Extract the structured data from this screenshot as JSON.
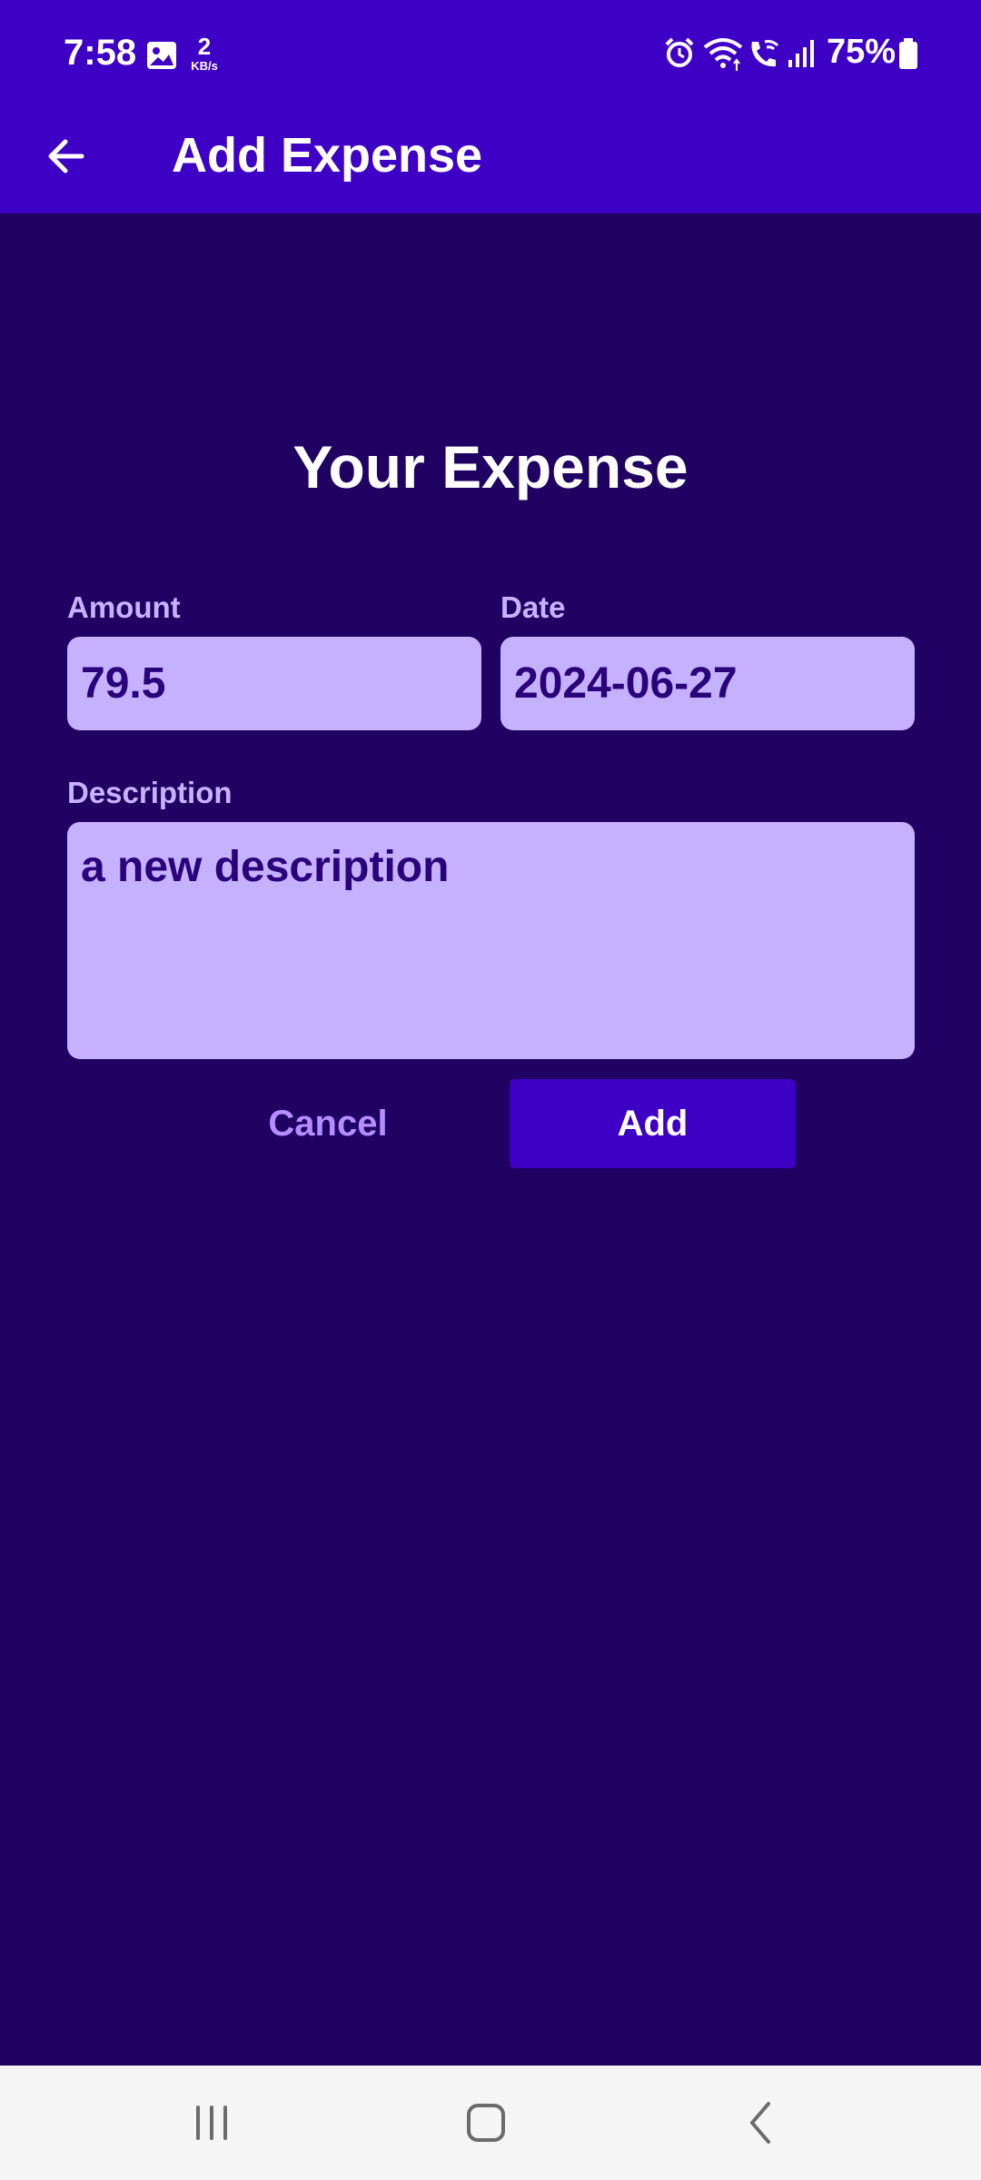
{
  "status": {
    "time": "7:58",
    "speed_value": "2",
    "speed_unit": "KB/s",
    "battery_percent": "75%",
    "icons": [
      "image-icon",
      "alarm-icon",
      "wifi-icon",
      "wifi-calling-icon",
      "signal-icon",
      "battery-icon"
    ]
  },
  "app_bar": {
    "title": "Add Expense",
    "back_icon": "arrow-left-icon"
  },
  "form": {
    "title": "Your Expense",
    "amount_label": "Amount",
    "amount_value": "79.5",
    "date_label": "Date",
    "date_value": "2024-06-27",
    "description_label": "Description",
    "description_value": "a new description"
  },
  "actions": {
    "cancel_label": "Cancel",
    "add_label": "Add"
  },
  "nav": {
    "icons": [
      "recent-apps-icon",
      "home-icon",
      "back-icon"
    ]
  },
  "colors": {
    "app_bar": "#3f00c6",
    "background": "#200262",
    "field_bg": "#c6b1ff",
    "field_text": "#2a037a",
    "label": "#c8b2ff",
    "cancel": "#b48dff"
  }
}
